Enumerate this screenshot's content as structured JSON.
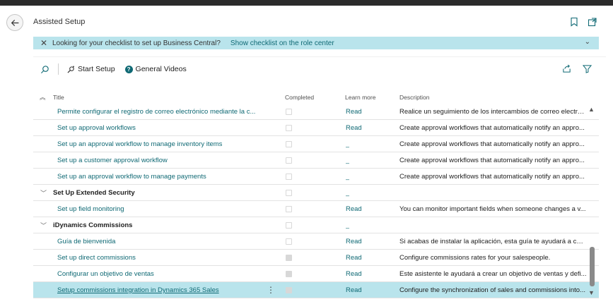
{
  "page": {
    "title": "Assisted Setup"
  },
  "banner": {
    "text": "Looking for your checklist to set up Business Central?",
    "link": "Show checklist on the role center"
  },
  "toolbar": {
    "start_setup": "Start Setup",
    "general_videos": "General Videos"
  },
  "columns": {
    "title": "Title",
    "completed": "Completed",
    "learn_more": "Learn more",
    "description": "Description"
  },
  "rows": [
    {
      "title": "Permite configurar el registro de correo electrónico mediante la c...",
      "group": false,
      "completed": false,
      "learn": "Read",
      "desc": "Realice un seguimiento de los intercambios de correo electró..."
    },
    {
      "title": "Set up approval workflows",
      "group": false,
      "completed": false,
      "learn": "Read",
      "desc": "Create approval workflows that automatically notify an appro..."
    },
    {
      "title": "Set up an approval workflow to manage inventory items",
      "group": false,
      "completed": false,
      "learn": "_",
      "desc": "Create approval workflows that automatically notify an appro..."
    },
    {
      "title": "Set up a customer approval workflow",
      "group": false,
      "completed": false,
      "learn": "_",
      "desc": "Create approval workflows that automatically notify an appro..."
    },
    {
      "title": "Set up an approval workflow to manage payments",
      "group": false,
      "completed": false,
      "learn": "_",
      "desc": "Create approval workflows that automatically notify an appro..."
    },
    {
      "title": "Set Up Extended Security",
      "group": true,
      "completed": false,
      "learn": "_",
      "desc": ""
    },
    {
      "title": "Set up field monitoring",
      "group": false,
      "completed": false,
      "learn": "Read",
      "desc": "You can monitor important fields when someone changes a v..."
    },
    {
      "title": "iDynamics Commissions",
      "group": true,
      "completed": false,
      "learn": "_",
      "desc": ""
    },
    {
      "title": "Guía de bienvenida",
      "group": false,
      "completed": false,
      "learn": "Read",
      "desc": "Si acabas de instalar la aplicación, esta guía te ayudará a con..."
    },
    {
      "title": "Set up direct commissions",
      "group": false,
      "completed": true,
      "learn": "Read",
      "desc": "Configure commissions rates for your salespeople."
    },
    {
      "title": "Configurar un objetivo de ventas",
      "group": false,
      "completed": true,
      "learn": "Read",
      "desc": "Este asistente le ayudará a crear un objetivo de ventas y defi..."
    },
    {
      "title": "Setup commissions integration in Dynamics 365 Sales",
      "group": false,
      "completed": true,
      "learn": "Read",
      "desc": "Configure the synchronization of sales and commissions into...",
      "selected": true
    }
  ],
  "icons": {
    "back": "arrow-left-icon",
    "bookmark": "bookmark-icon",
    "open_new": "open-new-window-icon",
    "search": "search-icon",
    "start_setup": "wizard-icon",
    "videos": "help-circle-icon",
    "share": "share-icon",
    "filter": "filter-icon"
  }
}
